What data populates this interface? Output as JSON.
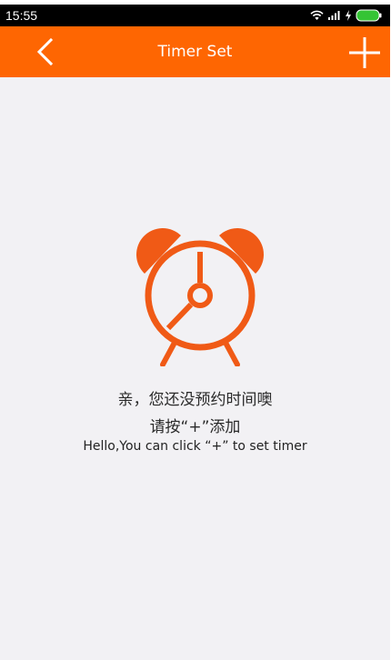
{
  "status_bar": {
    "time": "15:55",
    "icons": [
      "wifi-icon",
      "signal-icon",
      "charging-icon",
      "battery-icon"
    ],
    "battery_color": "#35c435"
  },
  "header": {
    "title": "Timer Set",
    "back_icon": "chevron-left-icon",
    "add_icon": "plus-icon",
    "background_color": "#fe6602"
  },
  "empty_state": {
    "icon": "alarm-clock-icon",
    "icon_color": "#f05a16",
    "line1": "亲，您还没预约时间噢",
    "line2": "请按“+”添加",
    "line3": "Hello,You can click “+” to set timer"
  },
  "colors": {
    "accent": "#fe6602",
    "background": "#f2f1f4"
  }
}
